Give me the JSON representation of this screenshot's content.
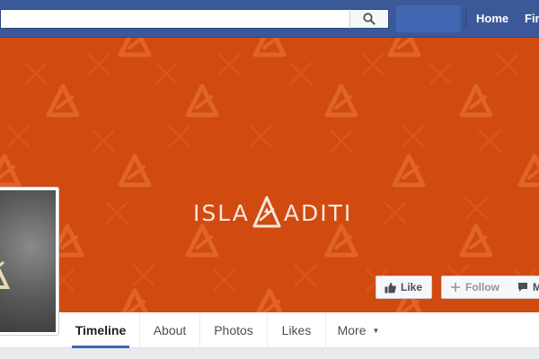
{
  "topbar": {
    "search_placeholder": "",
    "nav": [
      {
        "label": "Home"
      },
      {
        "label": "Fir"
      }
    ]
  },
  "cover": {
    "title_left": "ISLA",
    "title_right": "ADITI",
    "background_color": "#d14a10"
  },
  "actions": {
    "like_label": "Like",
    "follow_label": "Follow",
    "message_label": "M"
  },
  "tabs": [
    {
      "label": "Timeline",
      "active": true
    },
    {
      "label": "About"
    },
    {
      "label": "Photos"
    },
    {
      "label": "Likes"
    },
    {
      "label": "More"
    }
  ],
  "icons": {
    "search": "magnifier-icon",
    "like": "thumbs-up-icon",
    "follow": "plus-icon",
    "message": "speech-bubble-icon",
    "more": "caret-down-icon"
  }
}
